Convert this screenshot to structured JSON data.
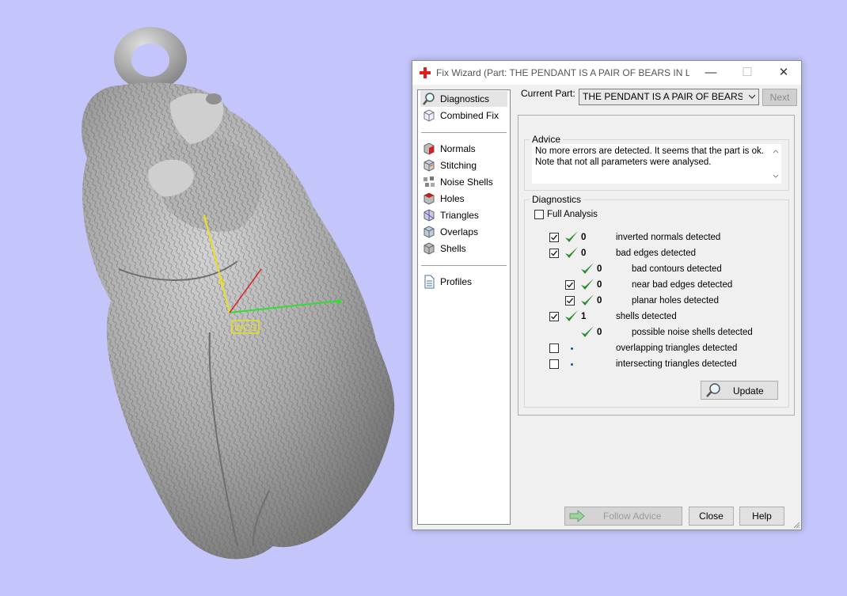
{
  "window": {
    "title": "Fix Wizard (Part: THE PENDANT IS A PAIR OF BEARS IN LOV...",
    "minimize": "—",
    "maximize": "☐",
    "close": "✕"
  },
  "nav": {
    "items": [
      {
        "label": "Diagnostics",
        "icon": "magnifier-icon",
        "selected": true
      },
      {
        "label": "Combined Fix",
        "icon": "cube-outline-icon"
      },
      {
        "label": "Normals",
        "icon": "normals-cube-icon"
      },
      {
        "label": "Stitching",
        "icon": "stitching-cube-icon"
      },
      {
        "label": "Noise Shells",
        "icon": "noise-shells-icon"
      },
      {
        "label": "Holes",
        "icon": "holes-cube-icon"
      },
      {
        "label": "Triangles",
        "icon": "triangles-cube-icon"
      },
      {
        "label": "Overlaps",
        "icon": "overlaps-cube-icon"
      },
      {
        "label": "Shells",
        "icon": "shells-cube-icon"
      },
      {
        "label": "Profiles",
        "icon": "document-icon"
      }
    ]
  },
  "current_part": {
    "label": "Current Part:",
    "value": "THE PENDANT IS A PAIR OF BEARS IN L",
    "next_label": "Next"
  },
  "advice": {
    "title": "Advice",
    "text_line1": "No more errors are detected. It seems that the part is ok.",
    "text_line2": "Note that not all parameters were analysed."
  },
  "diagnostics": {
    "title": "Diagnostics",
    "full_analysis_label": "Full Analysis",
    "full_analysis_checked": false,
    "rows": [
      {
        "checkbox": true,
        "checked": true,
        "status": "ok",
        "count": "0",
        "label": "inverted normals detected",
        "indent": 0
      },
      {
        "checkbox": true,
        "checked": true,
        "status": "ok",
        "count": "0",
        "label": "bad edges detected",
        "indent": 0
      },
      {
        "checkbox": false,
        "checked": false,
        "status": "ok",
        "count": "0",
        "label": "bad contours detected",
        "indent": 1
      },
      {
        "checkbox": true,
        "checked": true,
        "status": "ok",
        "count": "0",
        "label": "near bad edges detected",
        "indent": 1
      },
      {
        "checkbox": true,
        "checked": true,
        "status": "ok",
        "count": "0",
        "label": "planar holes detected",
        "indent": 1
      },
      {
        "checkbox": true,
        "checked": true,
        "status": "ok",
        "count": "1",
        "label": "shells detected",
        "indent": 0
      },
      {
        "checkbox": false,
        "checked": false,
        "status": "ok",
        "count": "0",
        "label": "possible noise shells detected",
        "indent": 1
      },
      {
        "checkbox": true,
        "checked": false,
        "status": "pending",
        "count": "",
        "label": "overlapping triangles detected",
        "indent": 0
      },
      {
        "checkbox": true,
        "checked": false,
        "status": "pending",
        "count": "",
        "label": "intersecting triangles detected",
        "indent": 0
      }
    ],
    "update_label": "Update"
  },
  "buttons": {
    "follow_advice": "Follow Advice",
    "close": "Close",
    "help": "Help"
  },
  "viewport": {
    "wcs_label": "WCS",
    "colors": {
      "x_axis": "#33dd33",
      "y_axis": "#e8e020",
      "z_axis": "#dd2222",
      "background": "#c4c6fb"
    }
  }
}
